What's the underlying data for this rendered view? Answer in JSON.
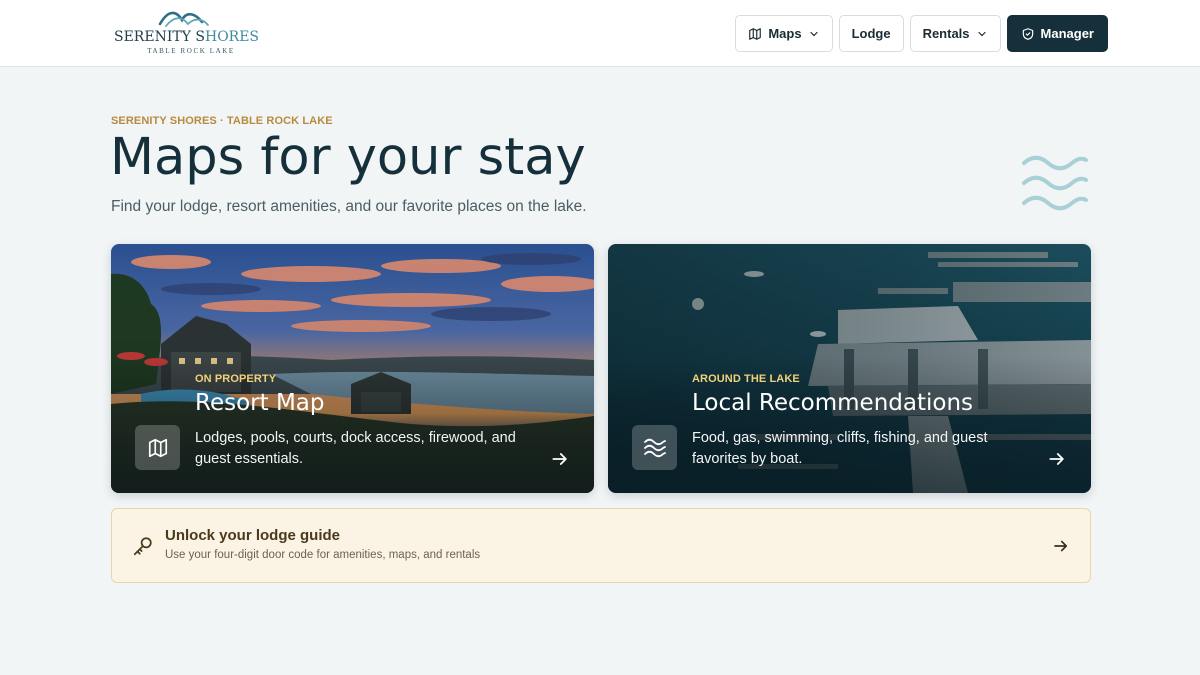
{
  "header": {
    "logo": {
      "brand_a": "SERENITY S",
      "brand_b": "HORES",
      "sub": "TABLE ROCK LAKE"
    },
    "nav": {
      "maps_label": "Maps",
      "lodge_label": "Lodge",
      "rentals_label": "Rentals",
      "manager_label": "Manager"
    }
  },
  "hero": {
    "eyebrow": "SERENITY SHORES · TABLE ROCK LAKE",
    "title": "Maps for your stay",
    "subtitle": "Find your lodge, resort amenities, and our favorite places on the lake."
  },
  "cards": [
    {
      "eyebrow": "ON PROPERTY",
      "title": "Resort Map",
      "description": "Lodges, pools, courts, dock access, firewood, and guest essentials.",
      "icon": "map-icon"
    },
    {
      "eyebrow": "AROUND THE LAKE",
      "title": "Local Recommendations",
      "description": "Food, gas, swimming, cliffs, fishing, and guest favorites by boat.",
      "icon": "waves-icon"
    }
  ],
  "unlock": {
    "title": "Unlock your lodge guide",
    "subtitle": "Use your four-digit door code for amenities, maps, and rentals"
  },
  "colors": {
    "accent_gold": "#b88a3e",
    "dark_navy": "#15303a",
    "page_bg": "#f1f5f6",
    "banner_bg": "#fbf4e4"
  }
}
